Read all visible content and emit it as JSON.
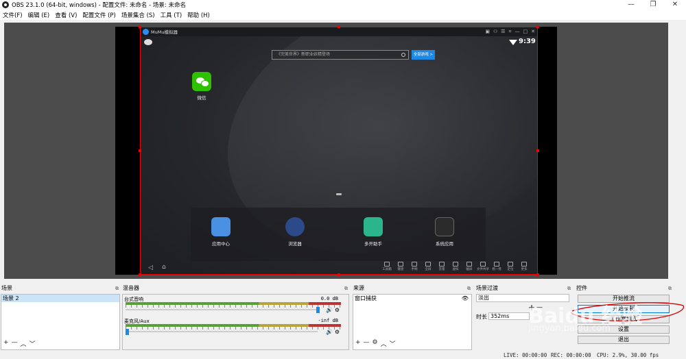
{
  "window": {
    "title": "OBS 23.1.0 (64-bit, windows) - 配置文件: 未命名 - 场景: 未命名",
    "minimize": "—",
    "maximize": "❐",
    "close": "✕"
  },
  "menu": [
    "文件(F)",
    "编辑 (E)",
    "查看 (V)",
    "配置文件 (P)",
    "场景集合 (S)",
    "工具 (T)",
    "帮助 (H)"
  ],
  "emulator": {
    "title": "MuMu模拟器",
    "time": "9:39",
    "search_placeholder": "《完美世界》新职业妖精登场",
    "all_games": "全部游戏 >",
    "desktop_app": "微信",
    "dock": [
      {
        "label": "应用中心",
        "color": "#4a90e2"
      },
      {
        "label": "浏览器",
        "color": "#2c4a8a"
      },
      {
        "label": "多开助手",
        "color": "#2bb58b"
      },
      {
        "label": "系统应用",
        "color": "#2b2b2b"
      }
    ],
    "tools": [
      "工具箱",
      "键盘",
      "手柄",
      "全屏",
      "音量",
      "虚拟",
      "截屏",
      "文件共享",
      "摇一摇",
      "定位",
      "更多"
    ]
  },
  "panels": {
    "scenes": {
      "title": "场景",
      "items": [
        "场景 2"
      ]
    },
    "mixer": {
      "title": "混音器",
      "channels": [
        {
          "name": "台式音响",
          "db": "0.0 dB",
          "level": 1.0
        },
        {
          "name": "麦克风/Aux",
          "db": "-inf dB",
          "level": 0.0
        }
      ]
    },
    "sources": {
      "title": "来源",
      "items": [
        "窗口捕获"
      ]
    },
    "transitions": {
      "title": "场景过渡",
      "selected": "淡出",
      "duration_label": "时长",
      "duration_value": "352ms"
    },
    "controls": {
      "title": "控件",
      "buttons": [
        "开始推流",
        "开始录制",
        "工作室模式",
        "设置",
        "退出"
      ]
    }
  },
  "status": {
    "live": "LIVE: 00:00:00",
    "rec": "REC: 00:00:00",
    "cpu": "CPU: 2.9%, 30.00 fps"
  },
  "watermark": {
    "main": "Baidu 经验",
    "sub": "jingyan.baidu.com"
  }
}
